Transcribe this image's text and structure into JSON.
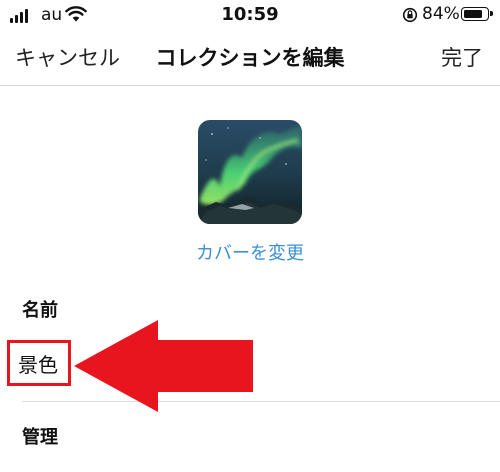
{
  "status_bar": {
    "carrier": "au",
    "time": "10:59",
    "battery": "84%",
    "battery_level": 0.84,
    "icons": [
      "signal-icon",
      "wifi-icon",
      "orientation-lock-icon",
      "battery-icon"
    ]
  },
  "nav": {
    "cancel": "キャンセル",
    "title": "コレクションを編集",
    "done": "完了"
  },
  "cover": {
    "image": "aurora-cover-thumbnail",
    "change_label": "カバーを変更"
  },
  "form": {
    "name_label": "名前",
    "name_value": "景色",
    "manage_label": "管理"
  },
  "annotation": {
    "arrow_color": "#e8141e",
    "highlight_color": "#e8141e",
    "accent_color": "#3d8fd6"
  }
}
